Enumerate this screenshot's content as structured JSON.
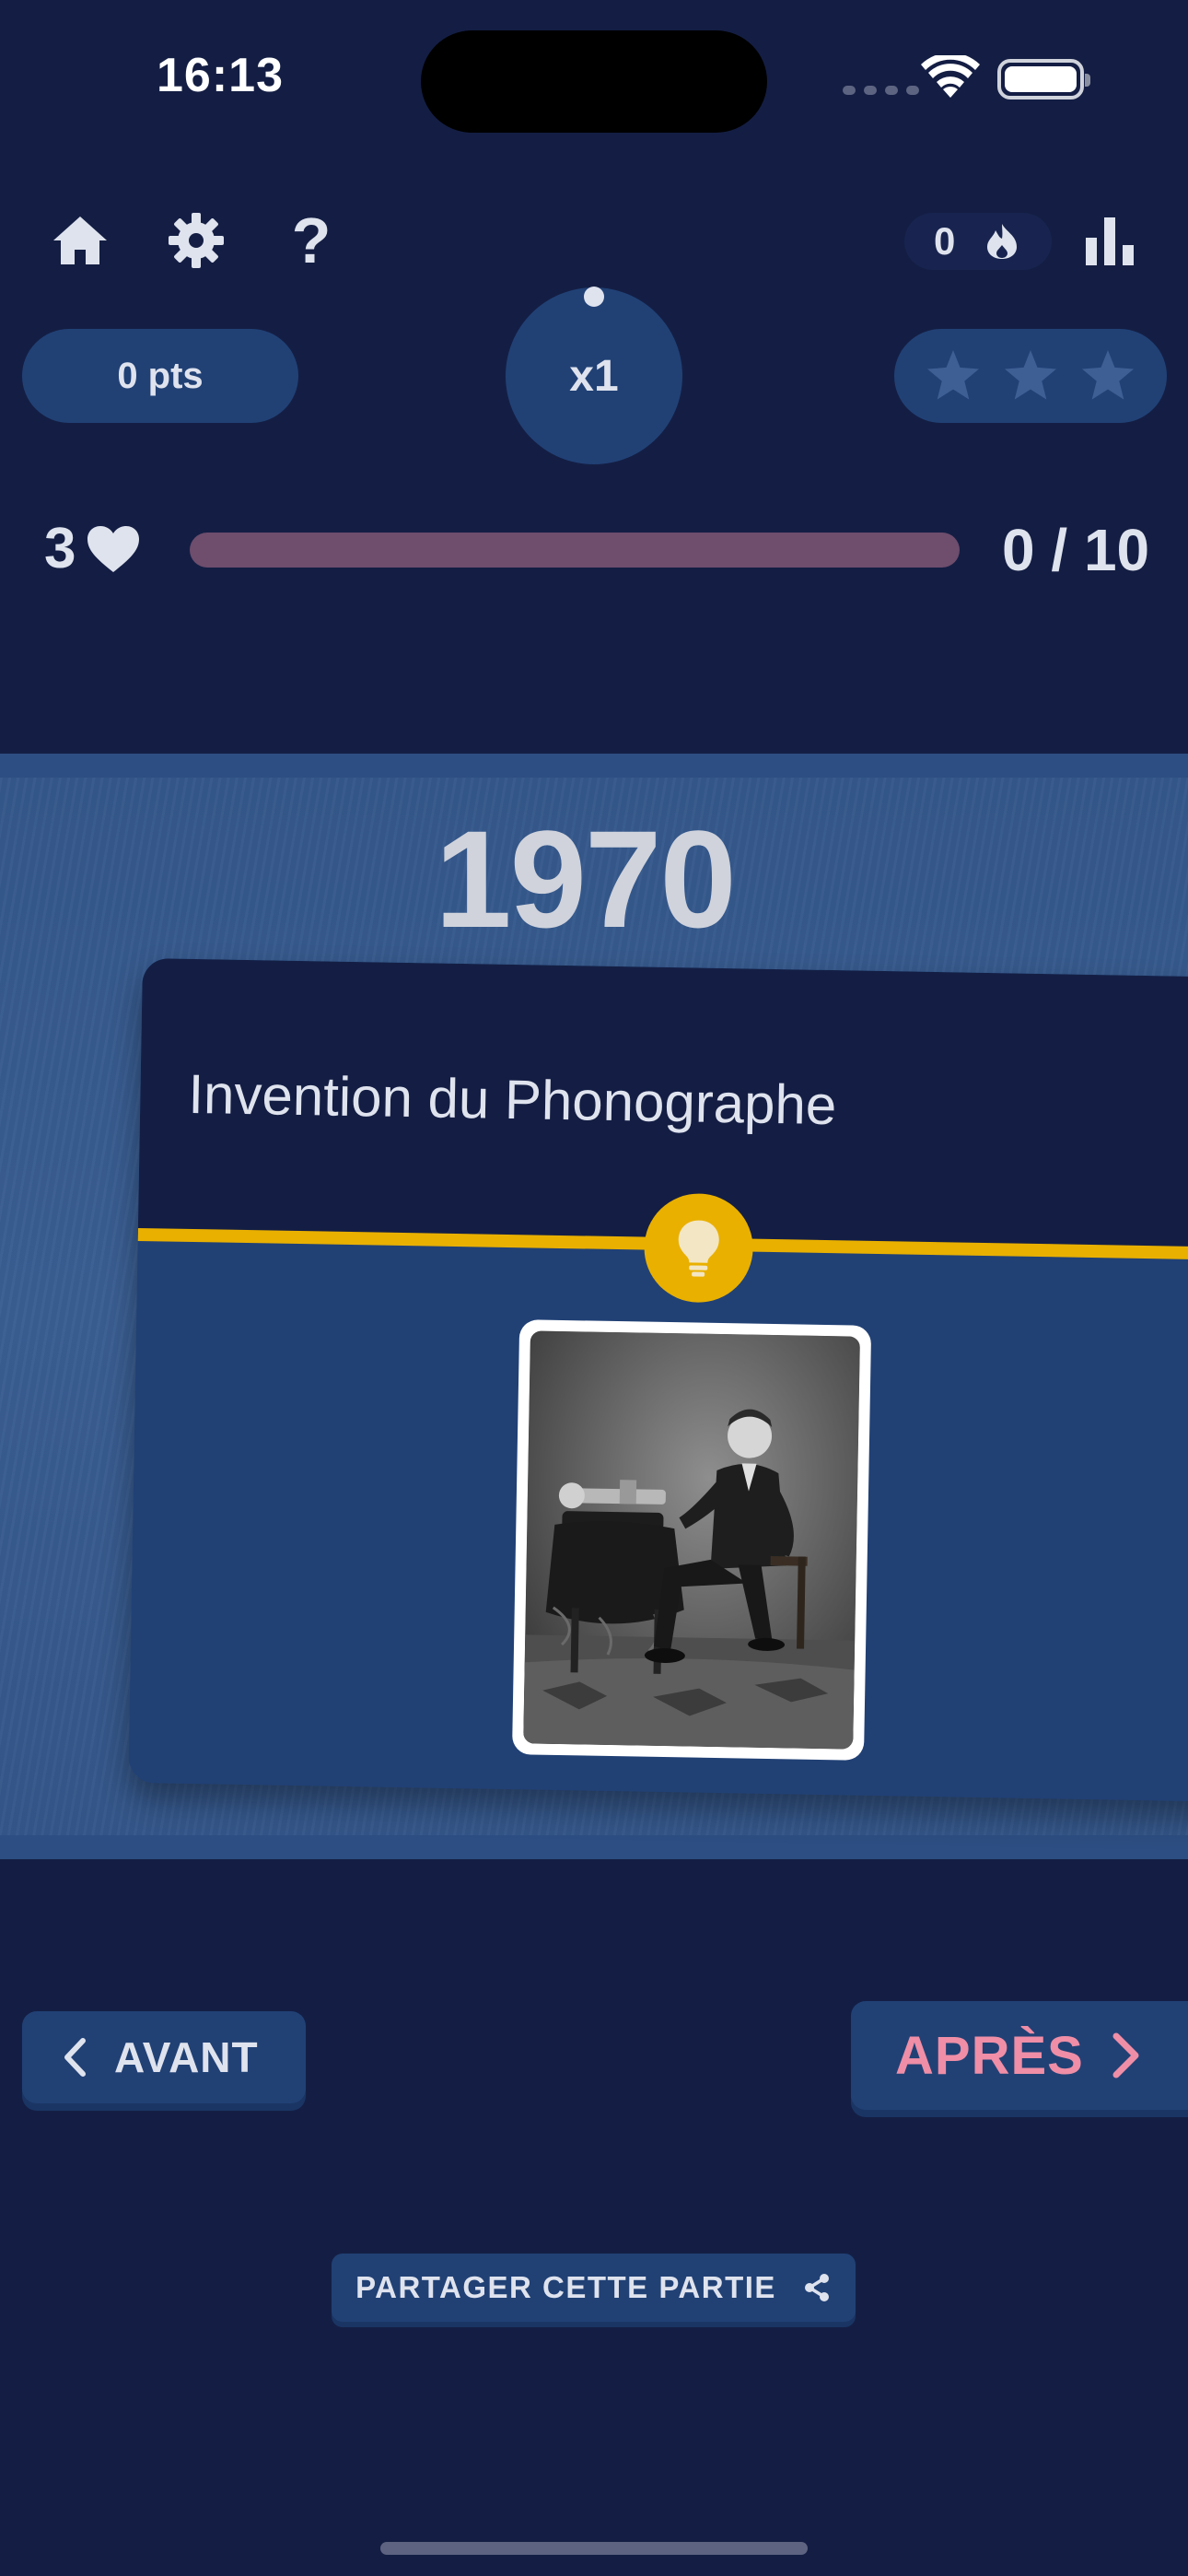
{
  "status_bar": {
    "time": "16:13"
  },
  "toolbar": {
    "home_icon": "home-icon",
    "settings_icon": "gear-icon",
    "help_label": "?",
    "streak_count": "0",
    "streak_icon": "flame-icon",
    "stats_icon": "bar-chart-icon"
  },
  "score": {
    "points": "0 pts",
    "multiplier": "x1",
    "stars_earned": 0,
    "stars_total": 3
  },
  "progress": {
    "lives": "3",
    "counter": "0 / 10",
    "fraction": 0
  },
  "board": {
    "year": "1970"
  },
  "card": {
    "title": "Invention du Phonographe",
    "category_icon": "lightbulb-icon",
    "image": "photo of a seated man beside a phonograph on a draped table"
  },
  "nav": {
    "before_label": "AVANT",
    "after_label": "APRÈS"
  },
  "share": {
    "label": "PARTAGER CETTE PARTIE"
  },
  "colors": {
    "background": "#141e44",
    "panel": "#214175",
    "accent_yellow": "#e9b000",
    "accent_pink": "#ef8ea6",
    "text": "#dfe3ee"
  }
}
